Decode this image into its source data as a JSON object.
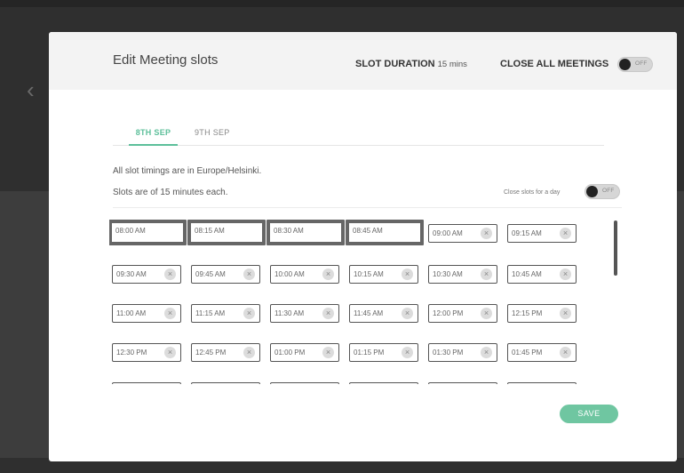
{
  "modal": {
    "title": "Edit Meeting slots",
    "slot_duration_label": "SLOT DURATION",
    "slot_duration_value": "15 mins",
    "close_all_label": "CLOSE ALL MEETINGS",
    "close_all_toggle": "OFF"
  },
  "tabs": [
    {
      "label": "8TH SEP",
      "active": true
    },
    {
      "label": "9TH SEP",
      "active": false
    }
  ],
  "info": {
    "timezone_text": "All slot timings are in Europe/Helsinki.",
    "duration_text": "Slots are of 15 minutes each.",
    "close_day_label": "Close slots for a day",
    "close_day_toggle": "OFF"
  },
  "slots": [
    {
      "time": "08:00 AM",
      "selected": true
    },
    {
      "time": "08:15 AM",
      "selected": true
    },
    {
      "time": "08:30 AM",
      "selected": true
    },
    {
      "time": "08:45 AM",
      "selected": true
    },
    {
      "time": "09:00 AM",
      "selected": false
    },
    {
      "time": "09:15 AM",
      "selected": false
    },
    {
      "time": "09:30 AM",
      "selected": false
    },
    {
      "time": "09:45 AM",
      "selected": false
    },
    {
      "time": "10:00 AM",
      "selected": false
    },
    {
      "time": "10:15 AM",
      "selected": false
    },
    {
      "time": "10:30 AM",
      "selected": false
    },
    {
      "time": "10:45 AM",
      "selected": false
    },
    {
      "time": "11:00 AM",
      "selected": false
    },
    {
      "time": "11:15 AM",
      "selected": false
    },
    {
      "time": "11:30 AM",
      "selected": false
    },
    {
      "time": "11:45 AM",
      "selected": false
    },
    {
      "time": "12:00 PM",
      "selected": false
    },
    {
      "time": "12:15 PM",
      "selected": false
    },
    {
      "time": "12:30 PM",
      "selected": false
    },
    {
      "time": "12:45 PM",
      "selected": false
    },
    {
      "time": "01:00 PM",
      "selected": false
    },
    {
      "time": "01:15 PM",
      "selected": false
    },
    {
      "time": "01:30 PM",
      "selected": false
    },
    {
      "time": "01:45 PM",
      "selected": false
    },
    {
      "time": "",
      "selected": false
    },
    {
      "time": "",
      "selected": false
    },
    {
      "time": "",
      "selected": false
    },
    {
      "time": "",
      "selected": false
    },
    {
      "time": "",
      "selected": false
    },
    {
      "time": "",
      "selected": false
    }
  ],
  "icons": {
    "remove": "close-circle-icon",
    "back": "chevron-left-icon"
  },
  "colors": {
    "accent": "#5cbf9a",
    "save_button": "#6fc6a1"
  },
  "save_label": "SAVE"
}
